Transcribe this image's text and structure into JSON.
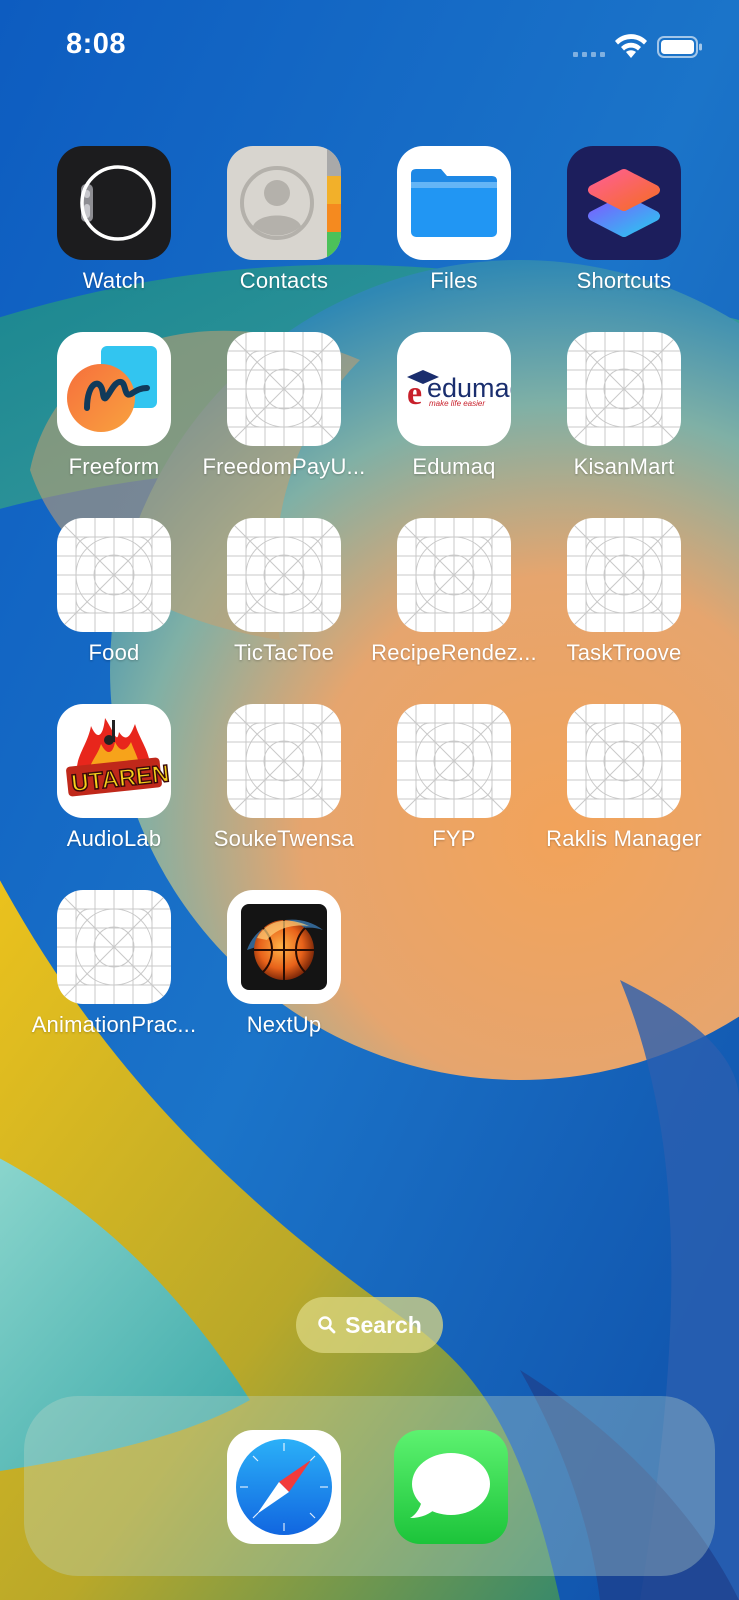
{
  "status_bar": {
    "time": "8:08",
    "icons": [
      "cellular-signal-icon",
      "wifi-icon",
      "battery-icon"
    ]
  },
  "home_screen": {
    "apps": [
      {
        "label": "Watch",
        "icon": "watch-icon"
      },
      {
        "label": "Contacts",
        "icon": "contacts-icon"
      },
      {
        "label": "Files",
        "icon": "files-folder-icon"
      },
      {
        "label": "Shortcuts",
        "icon": "shortcuts-icon"
      },
      {
        "label": "Freeform",
        "icon": "freeform-icon"
      },
      {
        "label": "FreedomPayU...",
        "icon": "placeholder-grid-icon"
      },
      {
        "label": "Edumaq",
        "icon": "edumaq-logo-icon"
      },
      {
        "label": "KisanMart",
        "icon": "placeholder-grid-icon"
      },
      {
        "label": "Food",
        "icon": "placeholder-grid-icon"
      },
      {
        "label": "TicTacToe",
        "icon": "placeholder-grid-icon"
      },
      {
        "label": "RecipeRendez...",
        "icon": "placeholder-grid-icon"
      },
      {
        "label": "TaskTroove",
        "icon": "placeholder-grid-icon"
      },
      {
        "label": "AudioLab",
        "icon": "utaren-logo-icon"
      },
      {
        "label": "SoukeTwensa",
        "icon": "placeholder-grid-icon"
      },
      {
        "label": "FYP",
        "icon": "placeholder-grid-icon"
      },
      {
        "label": "Raklis Manager",
        "icon": "placeholder-grid-icon"
      },
      {
        "label": "AnimationPrac...",
        "icon": "placeholder-grid-icon"
      },
      {
        "label": "NextUp",
        "icon": "basketball-icon"
      }
    ],
    "logo_text": {
      "edumaq": "edumaq",
      "edumaq_tagline": "make life easier",
      "utaren": "UTAREN"
    }
  },
  "search": {
    "label": "Search",
    "icon": "search-icon"
  },
  "dock": {
    "apps": [
      {
        "name": "Safari",
        "icon": "safari-compass-icon"
      },
      {
        "name": "Messages",
        "icon": "messages-bubble-icon"
      }
    ]
  },
  "colors": {
    "wallpaper_blue": "#1667c4",
    "wallpaper_orange": "#eda35e",
    "wallpaper_yellow": "#f4c419",
    "safari_blue": "#1d8ef5",
    "messages_green": "#3acf4f",
    "shortcuts_bg": "#1c1e5c"
  }
}
